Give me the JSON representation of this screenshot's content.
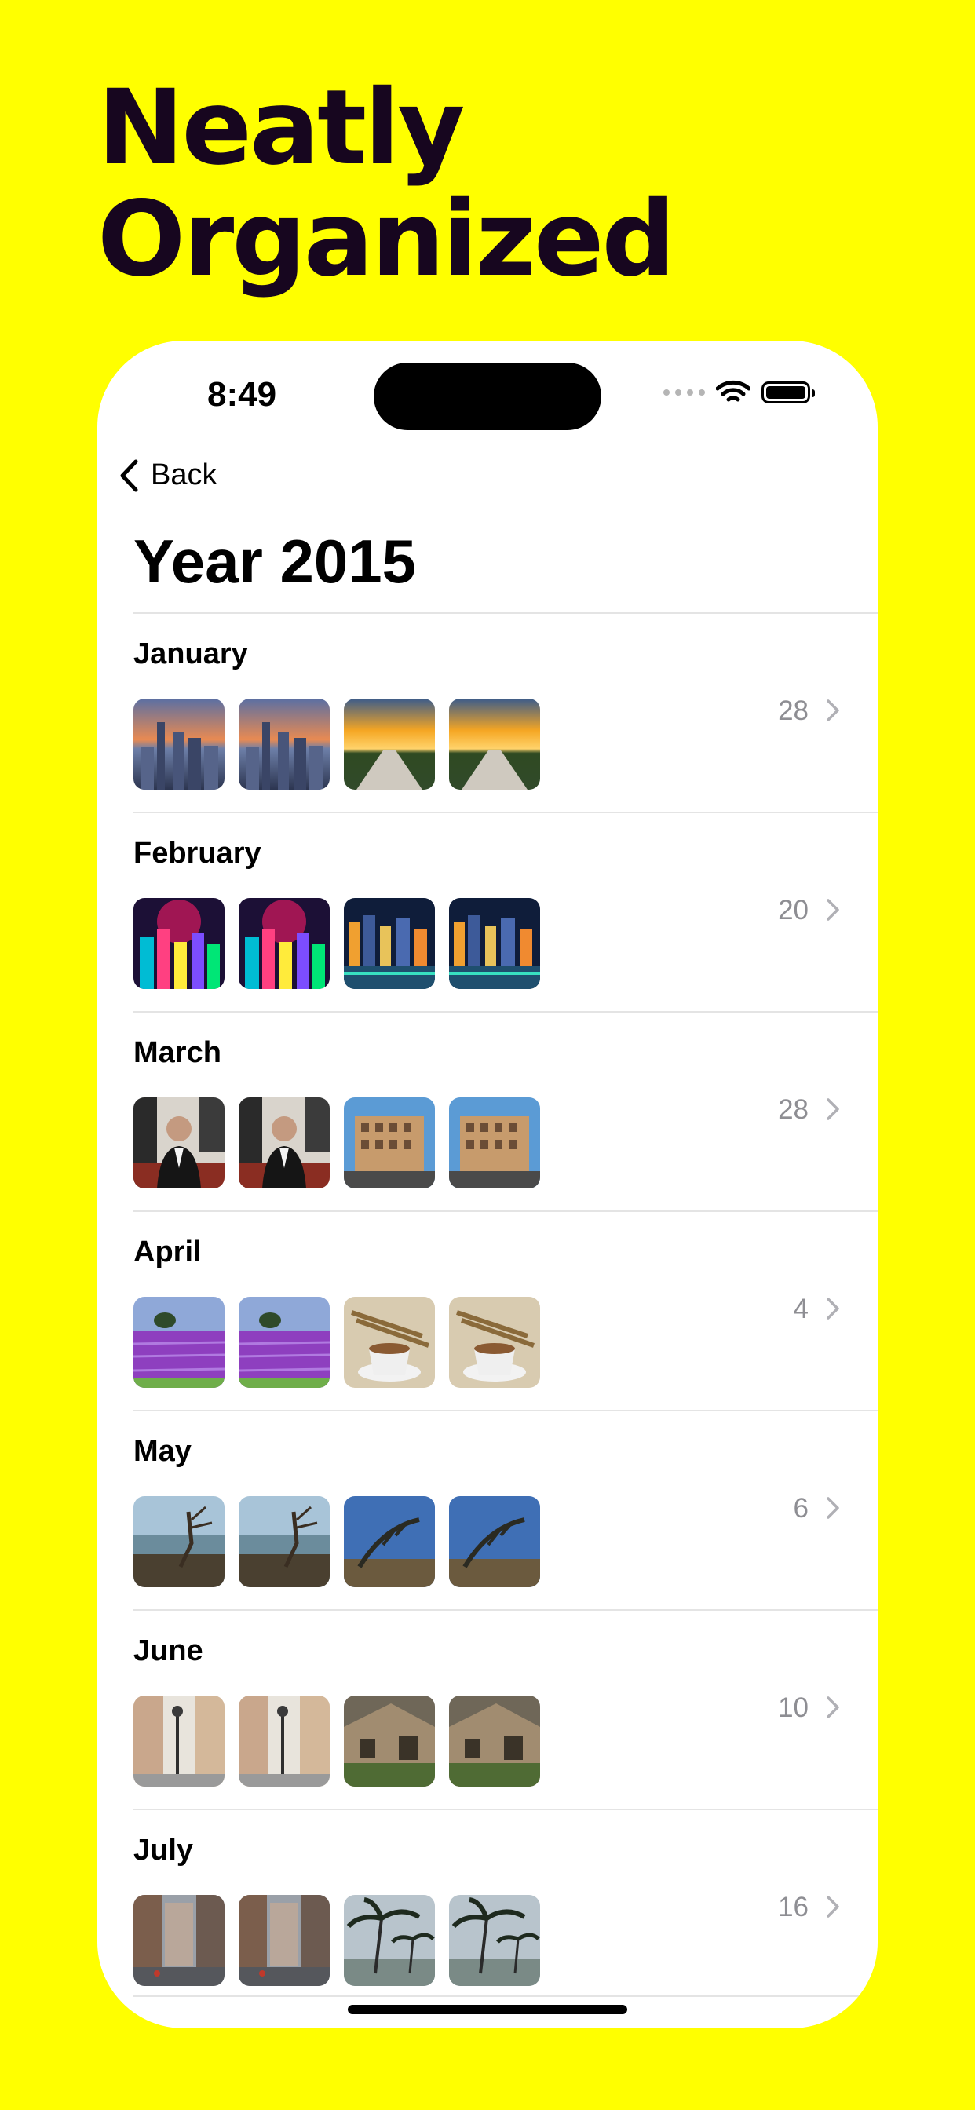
{
  "headline": {
    "line1": "Neatly",
    "line2": "Organized"
  },
  "status_bar": {
    "time": "8:49"
  },
  "nav": {
    "back_label": "Back"
  },
  "page_title": "Year 2015",
  "months": [
    {
      "name": "January",
      "count": "28",
      "thumbs": [
        "city-dusk",
        "city-dusk",
        "sunset-road",
        "sunset-road"
      ]
    },
    {
      "name": "February",
      "count": "20",
      "thumbs": [
        "neon-city",
        "neon-city",
        "harbor-night",
        "harbor-night"
      ]
    },
    {
      "name": "March",
      "count": "28",
      "thumbs": [
        "portrait-suit",
        "portrait-suit",
        "building-street",
        "building-street"
      ]
    },
    {
      "name": "April",
      "count": "4",
      "thumbs": [
        "lavender-field",
        "lavender-field",
        "coffee-cup",
        "coffee-cup"
      ]
    },
    {
      "name": "May",
      "count": "6",
      "thumbs": [
        "coast-tree",
        "coast-tree",
        "cypress-sky",
        "cypress-sky"
      ]
    },
    {
      "name": "June",
      "count": "10",
      "thumbs": [
        "street-lamp",
        "street-lamp",
        "stone-cottage",
        "stone-cottage"
      ]
    },
    {
      "name": "July",
      "count": "16",
      "thumbs": [
        "city-street",
        "city-street",
        "palm-beach",
        "palm-beach"
      ]
    }
  ],
  "colors": {
    "background": "#FFFF00",
    "headline": "#17061f",
    "count": "#8e8e93"
  }
}
